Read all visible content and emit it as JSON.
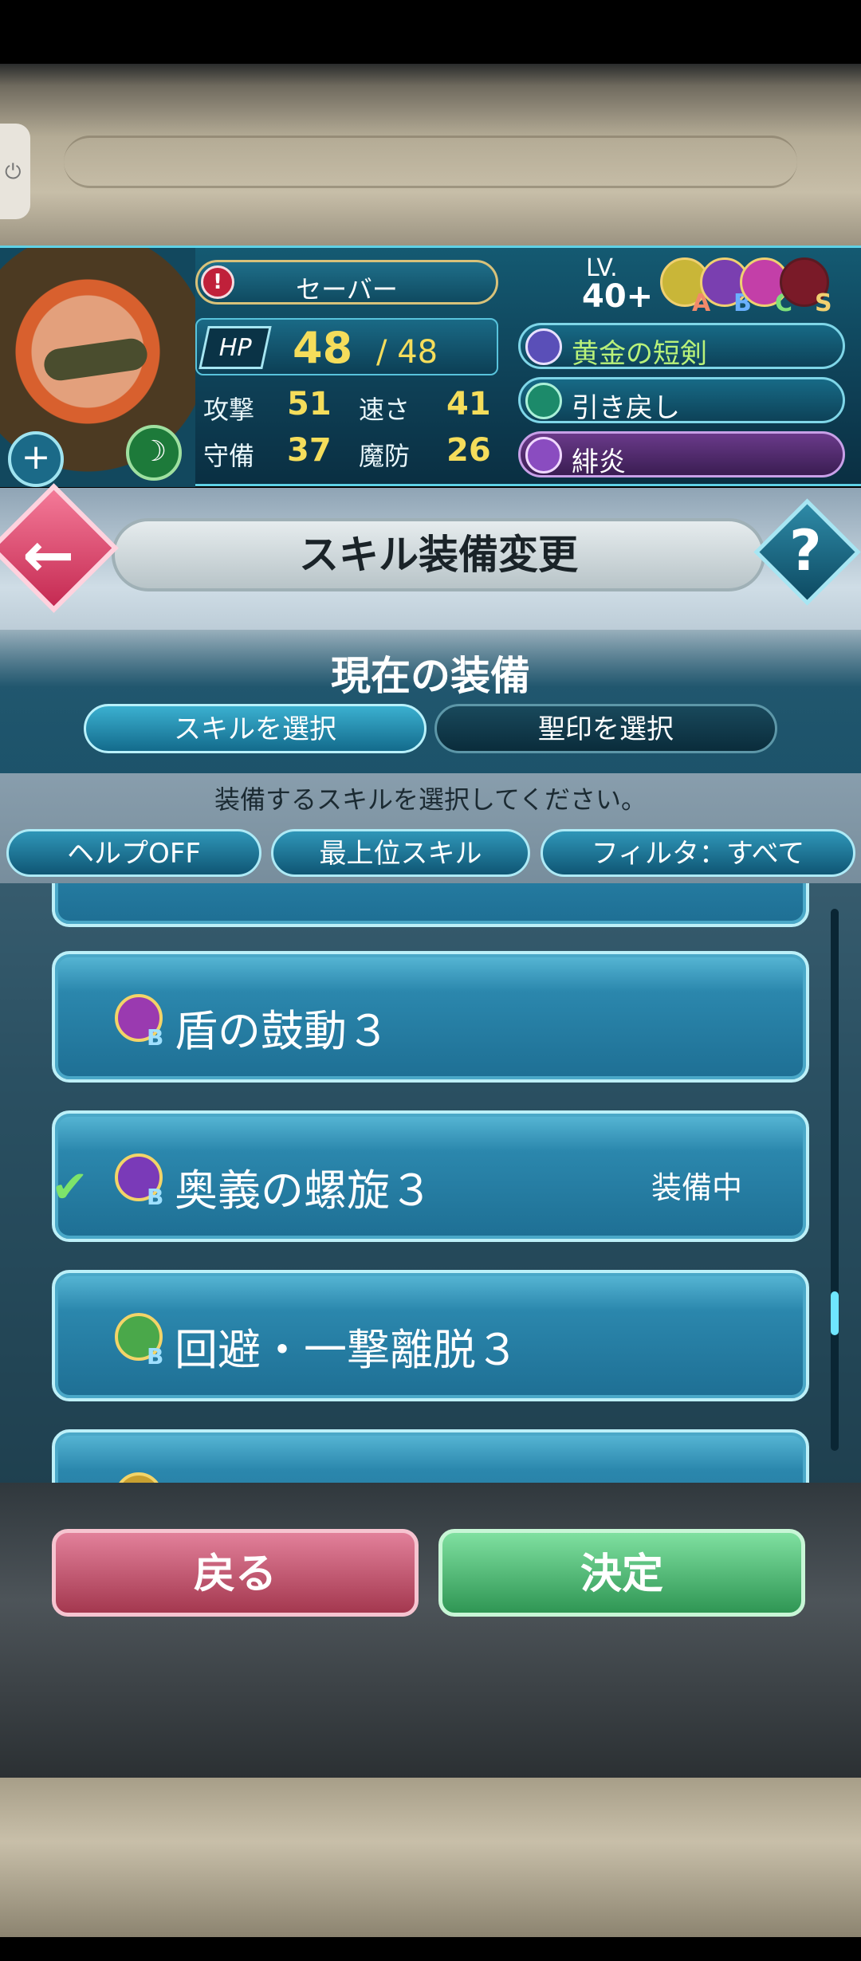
{
  "unit": {
    "name": "セーバー",
    "hp_label": "HP",
    "hp_current": "48",
    "hp_max": "/ 48",
    "stats": {
      "atk_label": "攻撃",
      "atk": "51",
      "spd_label": "速さ",
      "spd": "41",
      "def_label": "守備",
      "def": "37",
      "res_label": "魔防",
      "res": "26"
    },
    "level_label": "LV.",
    "level": "40+",
    "skill_slots": [
      "A",
      "B",
      "C",
      "S"
    ],
    "weapon": "黄金の短剣",
    "assist": "引き戻し",
    "special": "緋炎"
  },
  "header": {
    "title": "スキル装備変更",
    "help_label": "?"
  },
  "equip": {
    "heading": "現在の装備",
    "select_skill": "スキルを選択",
    "select_seal": "聖印を選択",
    "prompt": "装備するスキルを選択してください。"
  },
  "filters": {
    "help": "ヘルプOFF",
    "top_skill": "最上位スキル",
    "filter": "フィルタ：すべて"
  },
  "skills": [
    {
      "name": "盾の鼓動３",
      "slot": "B",
      "equipped_label": ""
    },
    {
      "name": "奥義の螺旋３",
      "slot": "B",
      "equipped_label": "装備中"
    },
    {
      "name": "回避・一撃離脱３",
      "slot": "B",
      "equipped_label": ""
    }
  ],
  "footer": {
    "back": "戻る",
    "confirm": "決定"
  },
  "colors": {
    "accent": "#5fd1e6",
    "stat_value": "#f5dd5b",
    "back_button": "#c84a66",
    "confirm_button": "#3fa862"
  }
}
